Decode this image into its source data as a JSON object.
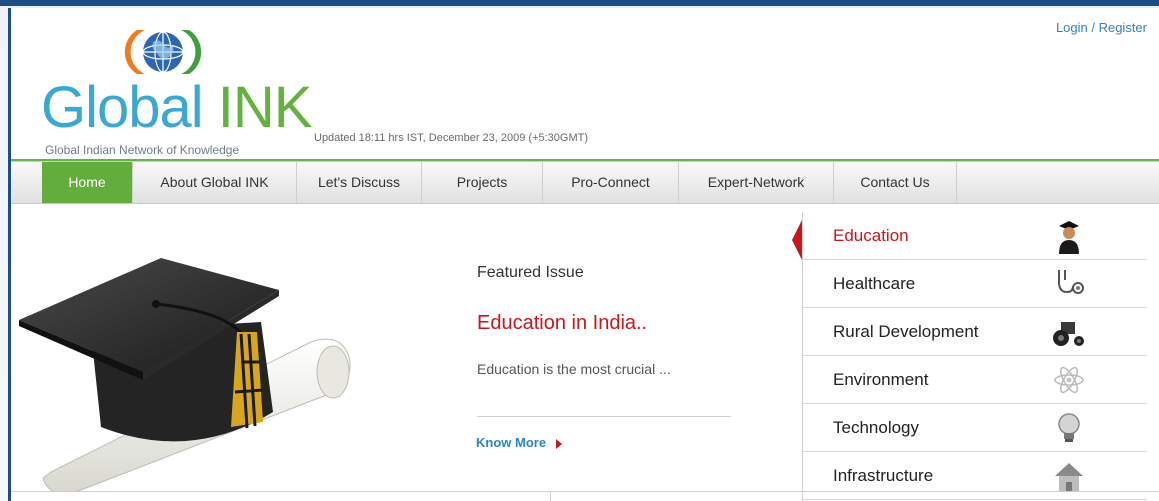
{
  "header": {
    "logo_prefix": "Global ",
    "logo_ink": "INK",
    "logo_tagline": "Global Indian Network of Knowledge",
    "updated": "Updated 18:11 hrs IST, December  23, 2009 (+5:30GMT)",
    "login_link": "Login / Register"
  },
  "nav": {
    "items": [
      {
        "label": "Home"
      },
      {
        "label": "About Global INK"
      },
      {
        "label": "Let's Discuss"
      },
      {
        "label": "Projects"
      },
      {
        "label": "Pro-Connect"
      },
      {
        "label": "Expert-Network"
      },
      {
        "label": "Contact Us"
      }
    ]
  },
  "featured": {
    "title": "Featured Issue",
    "issue": "Education in India..",
    "description": "Education is the most crucial ...",
    "know_more": "Know More"
  },
  "categories": [
    {
      "label": "Education",
      "icon": "graduate-icon"
    },
    {
      "label": "Healthcare",
      "icon": "stethoscope-icon"
    },
    {
      "label": "Rural Development",
      "icon": "tractor-icon"
    },
    {
      "label": "Environment",
      "icon": "atom-icon"
    },
    {
      "label": "Technology",
      "icon": "lightbulb-icon"
    },
    {
      "label": "Infrastructure",
      "icon": "house-icon"
    }
  ],
  "colors": {
    "brand_blue": "#3aa7d4",
    "brand_green": "#63b23e",
    "accent_red": "#c8161d",
    "link_blue": "#2f83c8"
  }
}
